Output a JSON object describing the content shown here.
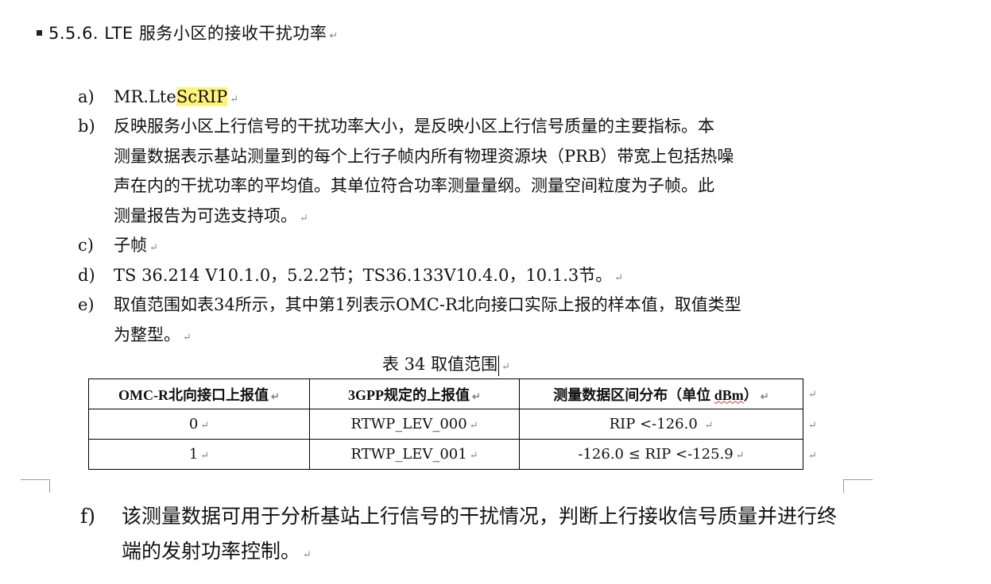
{
  "heading": {
    "text": "5.5.6. LTE 服务小区的接收干扰功率"
  },
  "para_mark": "↵",
  "items": {
    "a": {
      "label": "a)",
      "prefix": "MR.Lte",
      "highlight": "ScRIP"
    },
    "b": {
      "label": "b)",
      "lines": [
        "反映服务小区上行信号的干扰功率大小，是反映小区上行信号质量的主要指标。本",
        "测量数据表示基站测量到的每个上行子帧内所有物理资源块（PRB）带宽上包括热噪",
        "声在内的干扰功率的平均值。其单位符合功率测量量纲。测量空间粒度为子帧。此",
        "测量报告为可选支持项。"
      ]
    },
    "c": {
      "label": "c)",
      "text": "子帧"
    },
    "d": {
      "label": "d)",
      "text": "TS 36.214 V10.1.0，5.2.2节；TS36.133V10.4.0，10.1.3节。"
    },
    "e": {
      "label": "e)",
      "lines": [
        "取值范围如表34所示，其中第1列表示OMC-R北向接口实际上报的样本值，取值类型",
        "为整型。"
      ]
    },
    "f": {
      "label": "f)",
      "lines": [
        "该测量数据可用于分析基站上行信号的干扰情况，判断上行接收信号质量并进行终",
        "端的发射功率控制。"
      ]
    }
  },
  "table": {
    "caption": "表 34 取值范围",
    "headers": [
      "OMC-R北向接口上报值",
      "3GPP规定的上报值",
      "测量数据区间分布（单位 dBm）"
    ],
    "header3_prefix": "测量数据区间分布（单位 ",
    "header3_unit": "dBm",
    "header3_suffix": "）",
    "rows": [
      [
        "0",
        "RTWP_LEV_000",
        "RIP <-126.0 "
      ],
      [
        "1",
        "RTWP_LEV_001",
        "-126.0 ≤ RIP <-125.9"
      ]
    ]
  }
}
